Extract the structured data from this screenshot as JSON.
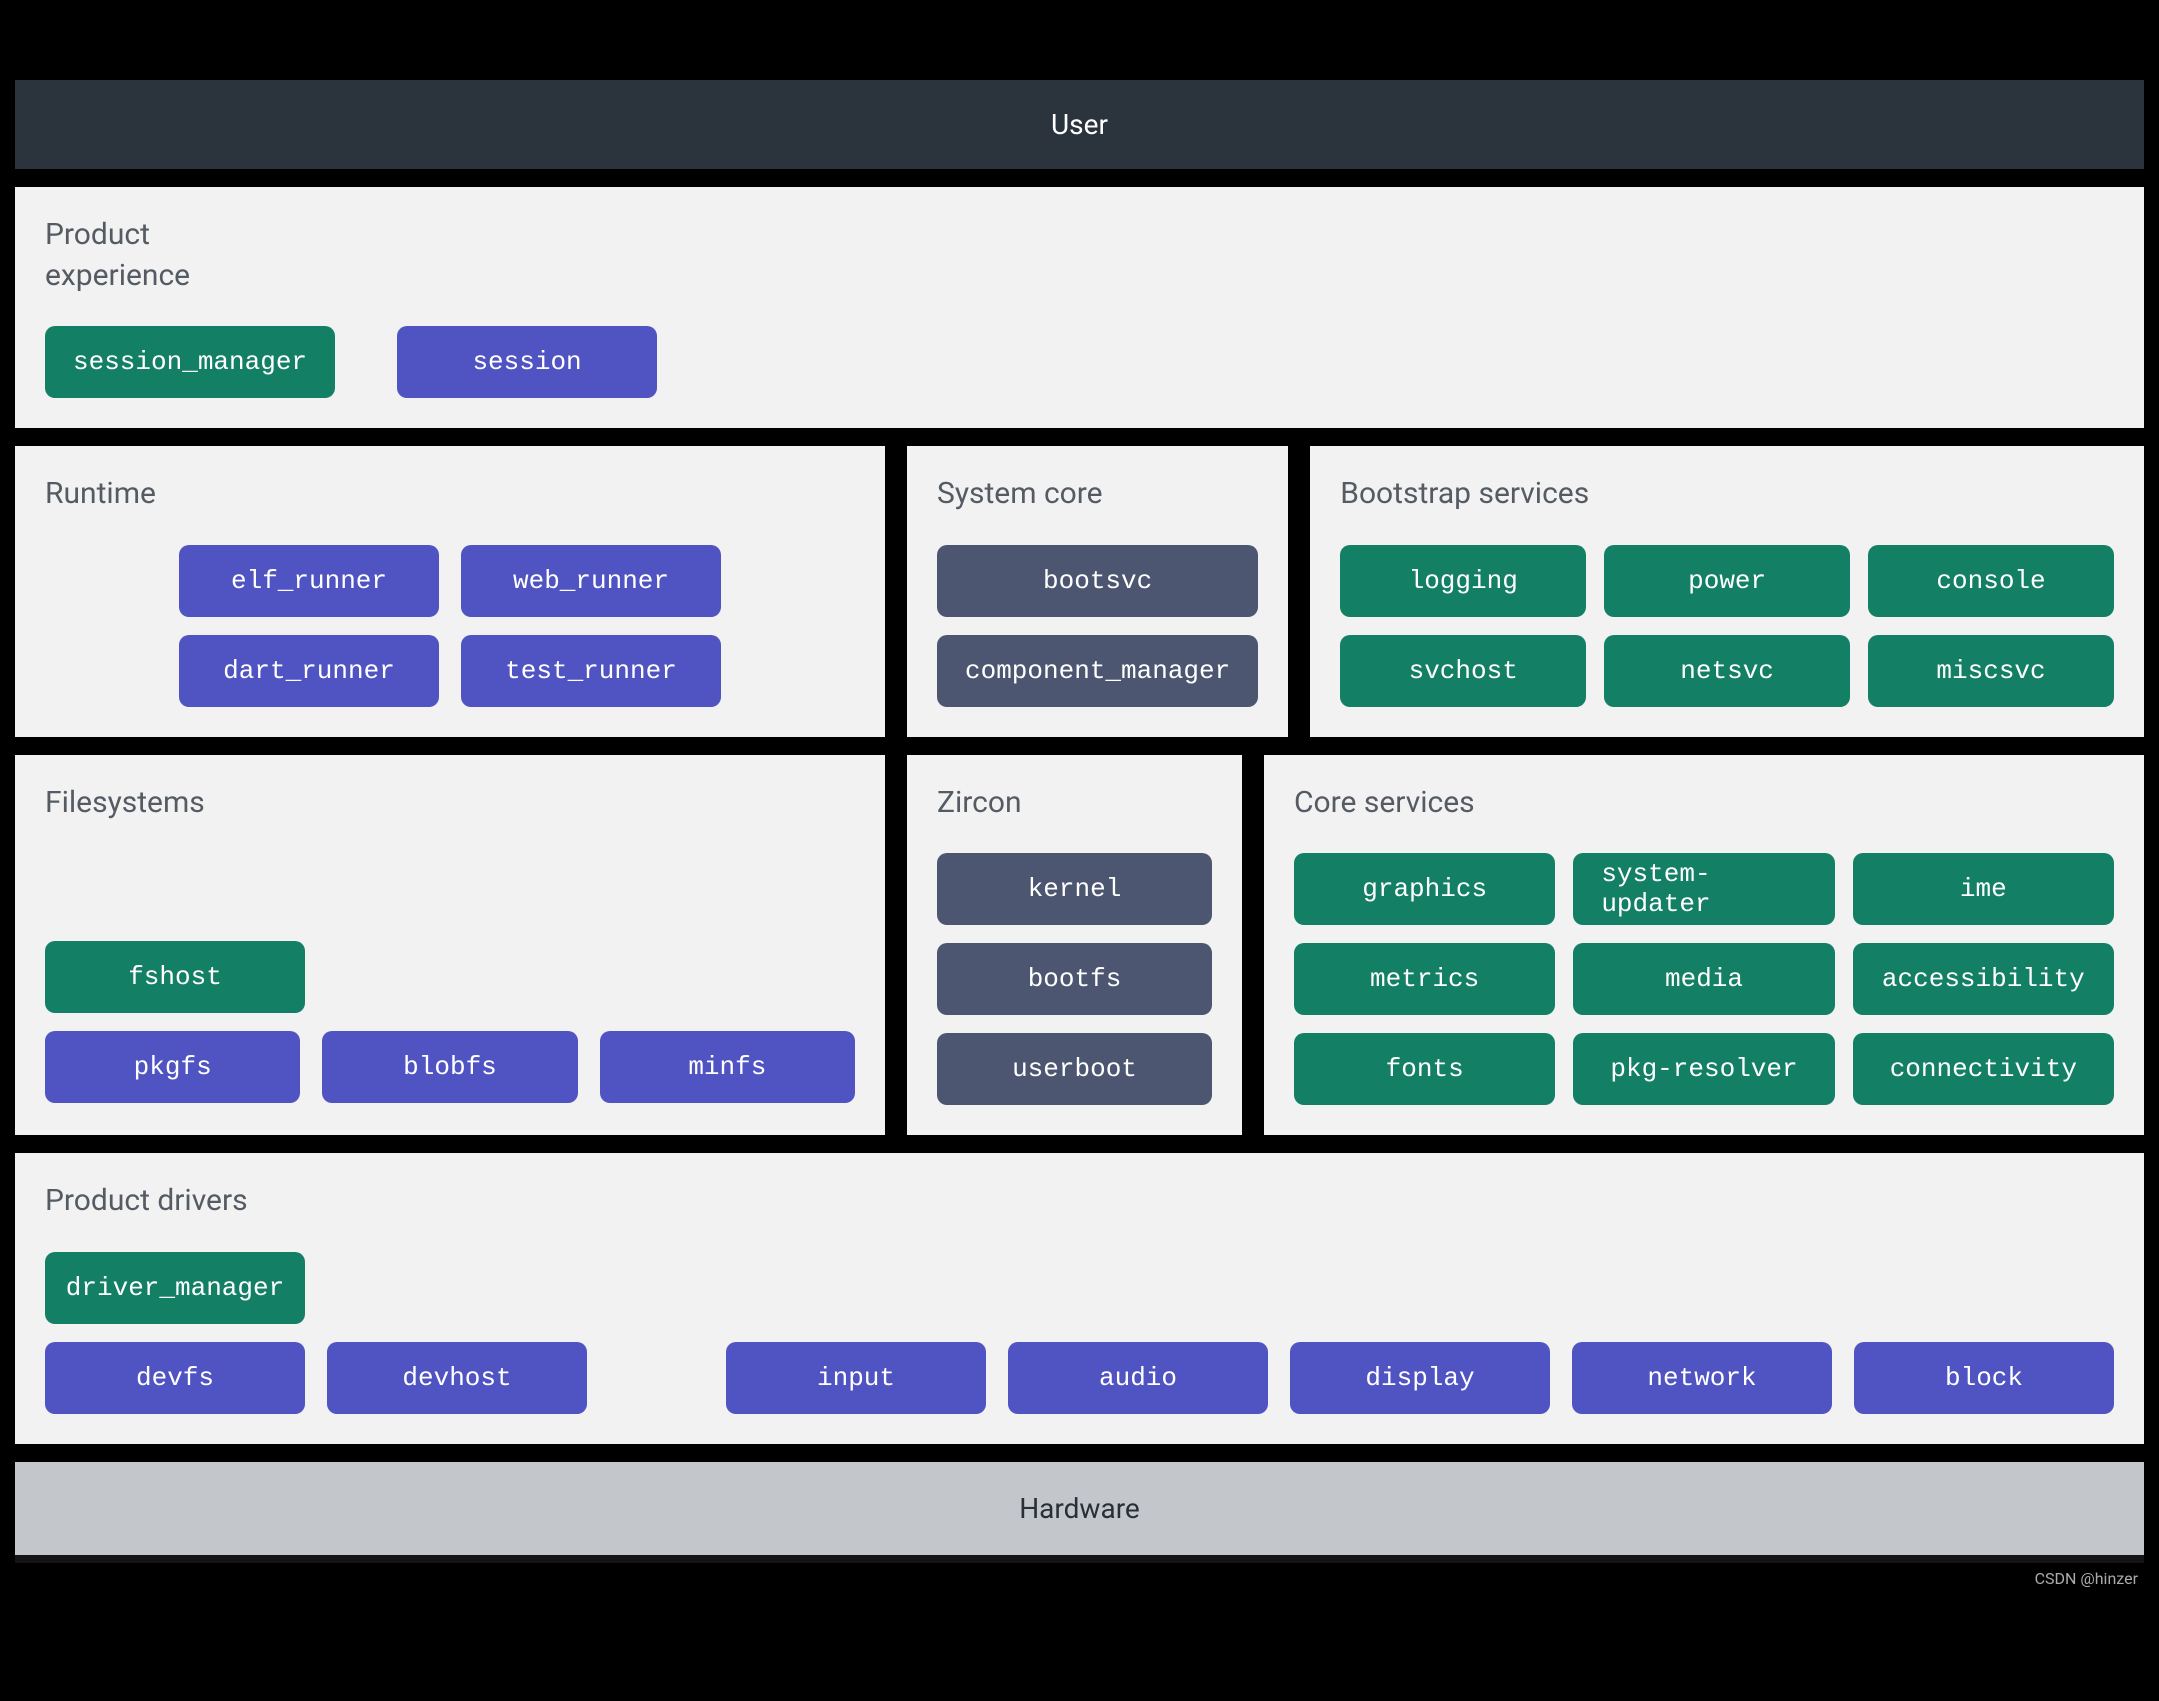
{
  "user_bar": "User",
  "hardware_bar": "Hardware",
  "watermark": "CSDN @hinzer",
  "product_experience": {
    "title": "Product\nexperience",
    "items": [
      {
        "label": "session_manager",
        "color": "green"
      },
      {
        "label": "session",
        "color": "purple"
      }
    ]
  },
  "runtime": {
    "title": "Runtime",
    "items": [
      {
        "label": "elf_runner",
        "color": "purple"
      },
      {
        "label": "web_runner",
        "color": "purple"
      },
      {
        "label": "dart_runner",
        "color": "purple"
      },
      {
        "label": "test_runner",
        "color": "purple"
      }
    ]
  },
  "system_core": {
    "title": "System core",
    "items": [
      {
        "label": "bootsvc",
        "color": "slate"
      },
      {
        "label": "component_manager",
        "color": "slate"
      }
    ]
  },
  "bootstrap": {
    "title": "Bootstrap services",
    "items": [
      {
        "label": "logging",
        "color": "green"
      },
      {
        "label": "power",
        "color": "green"
      },
      {
        "label": "console",
        "color": "green"
      },
      {
        "label": "svchost",
        "color": "green"
      },
      {
        "label": "netsvc",
        "color": "green"
      },
      {
        "label": "miscsvc",
        "color": "green"
      }
    ]
  },
  "filesystems": {
    "title": "Filesystems",
    "fshost": {
      "label": "fshost",
      "color": "green"
    },
    "row": [
      {
        "label": "pkgfs",
        "color": "purple"
      },
      {
        "label": "blobfs",
        "color": "purple"
      },
      {
        "label": "minfs",
        "color": "purple"
      }
    ]
  },
  "zircon": {
    "title": "Zircon",
    "items": [
      {
        "label": "kernel",
        "color": "slate"
      },
      {
        "label": "bootfs",
        "color": "slate"
      },
      {
        "label": "userboot",
        "color": "slate"
      }
    ]
  },
  "core_services": {
    "title": "Core services",
    "items": [
      {
        "label": "graphics",
        "color": "green"
      },
      {
        "label": "system-updater",
        "color": "green"
      },
      {
        "label": "ime",
        "color": "green"
      },
      {
        "label": "metrics",
        "color": "green"
      },
      {
        "label": "media",
        "color": "green"
      },
      {
        "label": "accessibility",
        "color": "green"
      },
      {
        "label": "fonts",
        "color": "green"
      },
      {
        "label": "pkg-resolver",
        "color": "green"
      },
      {
        "label": "connectivity",
        "color": "green"
      }
    ]
  },
  "product_drivers": {
    "title": "Product drivers",
    "manager": {
      "label": "driver_manager",
      "color": "green"
    },
    "left": [
      {
        "label": "devfs",
        "color": "purple"
      },
      {
        "label": "devhost",
        "color": "purple"
      }
    ],
    "right": [
      {
        "label": "input",
        "color": "purple"
      },
      {
        "label": "audio",
        "color": "purple"
      },
      {
        "label": "display",
        "color": "purple"
      },
      {
        "label": "network",
        "color": "purple"
      },
      {
        "label": "block",
        "color": "purple"
      }
    ]
  }
}
